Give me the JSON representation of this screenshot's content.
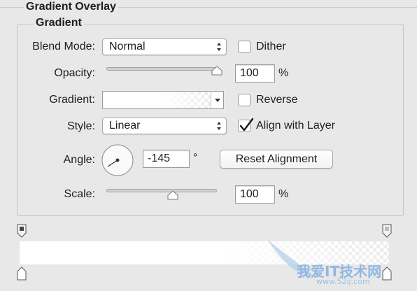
{
  "panel": {
    "title": "Gradient Overlay",
    "group_title": "Gradient"
  },
  "blend_mode": {
    "label": "Blend Mode:",
    "value": "Normal"
  },
  "dither": {
    "label": "Dither",
    "checked": false
  },
  "opacity": {
    "label": "Opacity:",
    "value": "100",
    "unit": "%",
    "slider_fraction": 1.0
  },
  "gradient": {
    "label": "Gradient:"
  },
  "reverse": {
    "label": "Reverse",
    "checked": false
  },
  "style": {
    "label": "Style:",
    "value": "Linear"
  },
  "align_with_layer": {
    "label": "Align with Layer",
    "checked": true
  },
  "angle": {
    "label": "Angle:",
    "value": "-145",
    "unit": "°"
  },
  "reset_alignment": {
    "label": "Reset Alignment"
  },
  "scale": {
    "label": "Scale:",
    "value": "100",
    "unit": "%",
    "slider_fraction": 0.6
  },
  "watermark": {
    "text": "我爱IT技术网",
    "url": "www.52ij.com"
  },
  "colors": {
    "background": "#e8e8e8",
    "watermark_blue": "#8fb8e0"
  }
}
